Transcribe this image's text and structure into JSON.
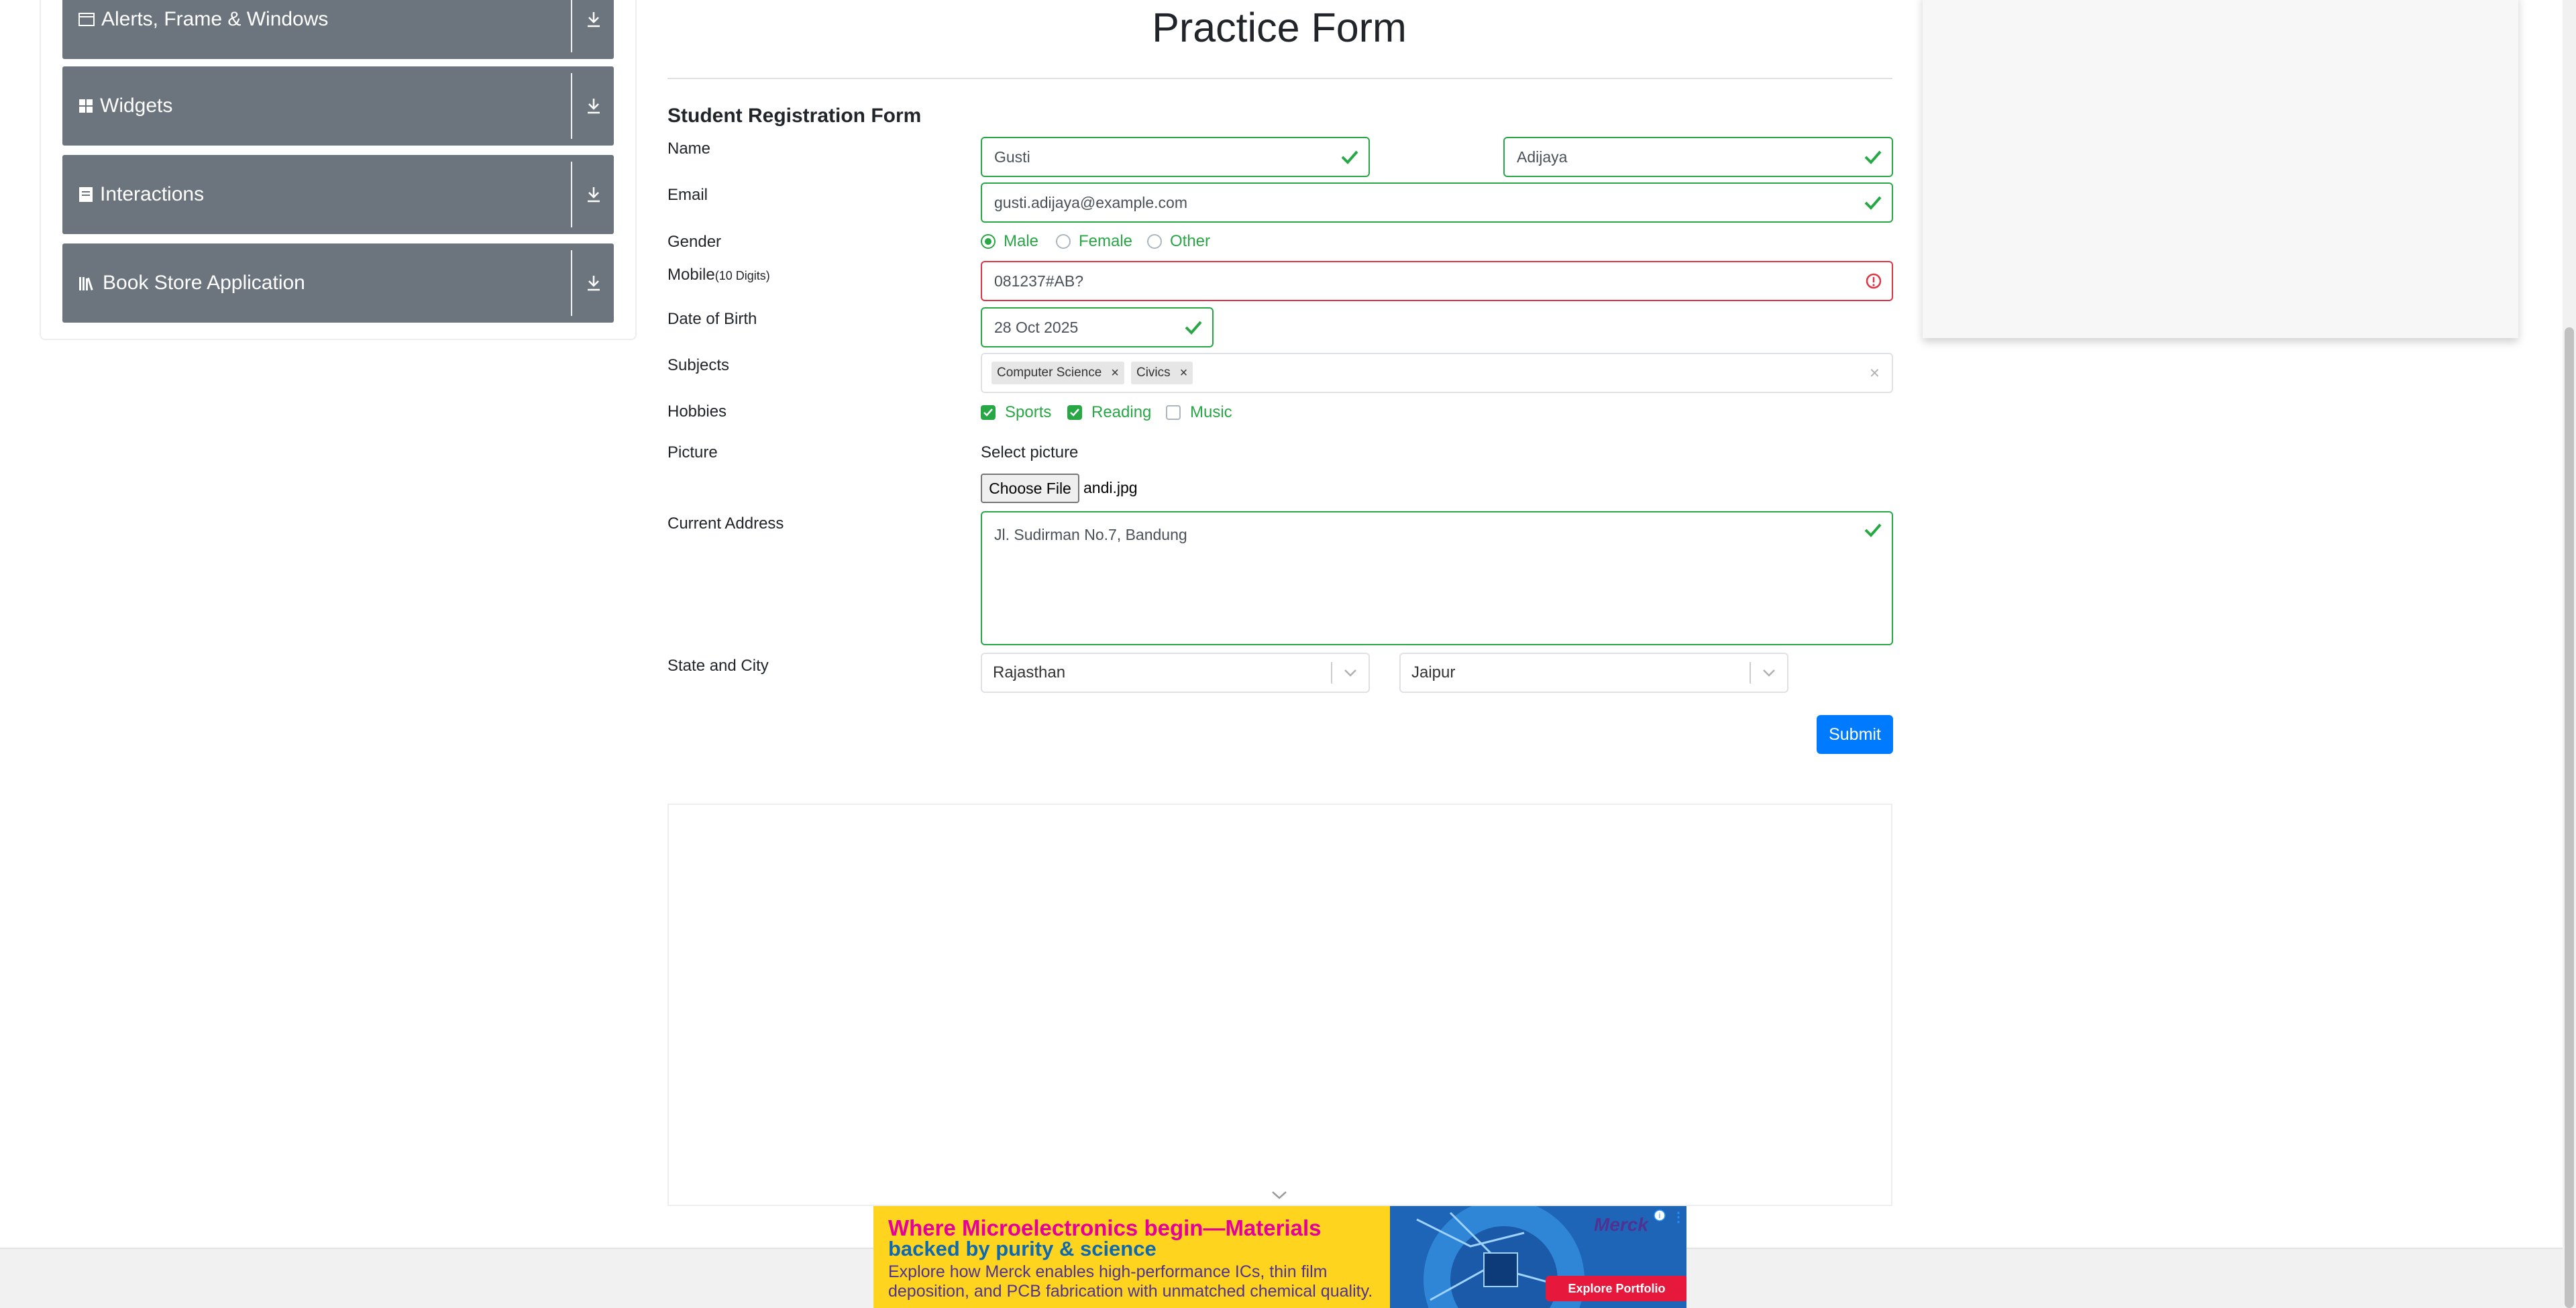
{
  "sidebar": {
    "groups": [
      {
        "label": "Alerts, Frame & Windows",
        "icon": "window-icon"
      },
      {
        "label": "Widgets",
        "icon": "widgets-icon"
      },
      {
        "label": "Interactions",
        "icon": "interactions-icon"
      },
      {
        "label": "Book Store Application",
        "icon": "book-store-icon"
      }
    ]
  },
  "form": {
    "page_title": "Practice Form",
    "subtitle": "Student Registration Form",
    "labels": {
      "name": "Name",
      "email": "Email",
      "gender": "Gender",
      "mobile": "Mobile",
      "mobile_hint": "(10 Digits)",
      "dob": "Date of Birth",
      "subjects": "Subjects",
      "hobbies": "Hobbies",
      "picture": "Picture",
      "address": "Current Address",
      "state_city": "State and City"
    },
    "first_name": "Gusti",
    "last_name": "Adijaya",
    "email": "gusti.adijaya@example.com",
    "gender_options": [
      {
        "label": "Male",
        "selected": true
      },
      {
        "label": "Female",
        "selected": false
      },
      {
        "label": "Other",
        "selected": false
      }
    ],
    "mobile": "081237#AB?",
    "dob": "28 Oct 2025",
    "subjects": [
      "Computer Science",
      "Civics"
    ],
    "hobbies": [
      {
        "label": "Sports",
        "checked": true
      },
      {
        "label": "Reading",
        "checked": true
      },
      {
        "label": "Music",
        "checked": false
      }
    ],
    "picture_label": "Select picture",
    "choose_file": "Choose File",
    "file_name": "andi.jpg",
    "address": "Jl. Sudirman No.7, Bandung",
    "state": "Rajasthan",
    "city": "Jaipur",
    "submit": "Submit"
  },
  "ad": {
    "headline1": "Where Microelectronics begin—Materials",
    "headline2": "backed by purity & science",
    "body": "Explore how Merck enables high-performance ICs, thin film deposition, and PCB fabrication with unmatched chemical quality.",
    "logo": "Merck",
    "cta": "Explore Portfolio"
  },
  "colors": {
    "valid": "#28a745",
    "invalid": "#dc3545",
    "primary": "#007bff",
    "sidebar_group": "#6c757d"
  }
}
